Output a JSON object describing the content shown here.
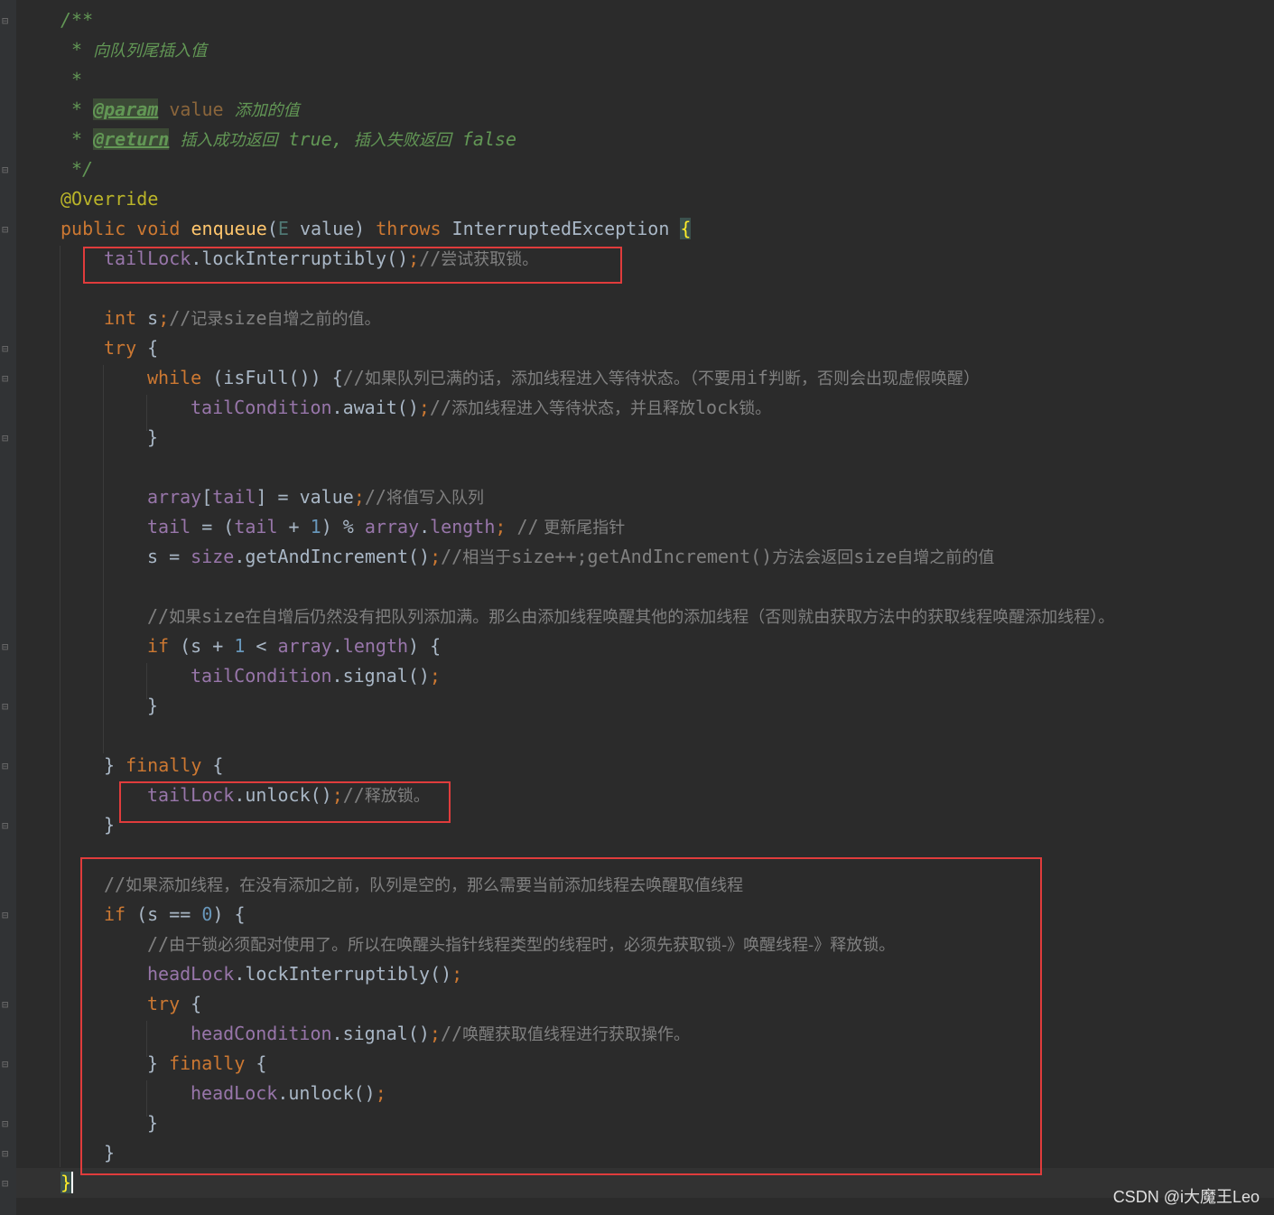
{
  "code": {
    "doc_open": "/**",
    "doc_line1_star": "*",
    "doc_line1_text": "向队列尾插入值",
    "doc_line2_star": "*",
    "doc_param_star": "*",
    "doc_param_tag": "@param",
    "doc_param_name": "value",
    "doc_param_desc": "添加的值",
    "doc_return_star": "*",
    "doc_return_tag": "@return",
    "doc_return_desc1": "插入成功返回",
    "doc_return_true": "true,",
    "doc_return_desc2": "插入失败返回",
    "doc_return_false": "false",
    "doc_close": "*/",
    "annotation": "@Override",
    "sig_public": "public",
    "sig_void": "void",
    "sig_name": "enqueue",
    "sig_paren_open": "(",
    "sig_type": "E",
    "sig_param": " value)",
    "sig_throws": "throws",
    "sig_exception": "InterruptedException",
    "sig_brace": "{",
    "l_taillock_field": "tailLock",
    "l_taillock_call": ".lockInterruptibly()",
    "l_taillock_semi": ";",
    "l_taillock_cmt_slash": "//",
    "l_taillock_cmt": "尝试获取锁。",
    "l_int_kw": "int",
    "l_int_var": " s",
    "l_int_semi": ";",
    "l_int_cmt_slash": "//",
    "l_int_cmt_a": "记录",
    "l_int_cmt_b": "size",
    "l_int_cmt_c": "自增之前的值。",
    "l_try_kw": "try",
    "l_try_brace": " {",
    "l_while_kw": "while",
    "l_while_cond": " (isFull()) {",
    "l_while_cmt_slash": "//",
    "l_while_cmt_a": "如果队列已满的话，添加线程进入等待状态。（不要用",
    "l_while_cmt_b": "if",
    "l_while_cmt_c": "判断，否则会出现虚假唤醒）",
    "l_await_field": "tailCondition",
    "l_await_call": ".await()",
    "l_await_semi": ";",
    "l_await_cmt_slash": "//",
    "l_await_cmt_a": "添加线程进入等待状态，并且释放",
    "l_await_cmt_b": "lock",
    "l_await_cmt_c": "锁。",
    "l_close1": "}",
    "l_arr_field": "array",
    "l_arr_b1": "[",
    "l_arr_tail": "tail",
    "l_arr_rest": "] = value",
    "l_arr_semi": ";",
    "l_arr_cmt_slash": "//",
    "l_arr_cmt": "将值写入队列",
    "l_tail_field": "tail",
    "l_tail_eq": " = (",
    "l_tail_field2": "tail",
    "l_tail_plus": " + ",
    "l_tail_one": "1",
    "l_tail_mod": ") % ",
    "l_tail_array": "array",
    "l_tail_dot": ".",
    "l_tail_length": "length",
    "l_tail_semi": ";",
    "l_tail_cmt_slash": " //",
    "l_tail_cmt": " 更新尾指针",
    "l_s_var": "s = ",
    "l_s_field": "size",
    "l_s_call": ".getAndIncrement()",
    "l_s_semi": ";",
    "l_s_cmt_slash": "//",
    "l_s_cmt_a": "相当于",
    "l_s_cmt_b": "size++;getAndIncrement()",
    "l_s_cmt_c": "方法会返回",
    "l_s_cmt_d": "size",
    "l_s_cmt_e": "自增之前的值",
    "l_long_cmt_slash": "//",
    "l_long_cmt_a": "如果",
    "l_long_cmt_b": "size",
    "l_long_cmt_c": "在自增后仍然没有把队列添加满。那么由添加线程唤醒其他的添加线程（否则就由获取方法中的获取线程唤醒添加线程）。",
    "l_if_kw": "if",
    "l_if_a": " (s + ",
    "l_if_one": "1",
    "l_if_lt": " < ",
    "l_if_array": "array",
    "l_if_dot": ".",
    "l_if_length": "length",
    "l_if_end": ") {",
    "l_signal_field": "tailCondition",
    "l_signal_call": ".signal()",
    "l_signal_semi": ";",
    "l_close2": "}",
    "l_finally_close": "} ",
    "l_finally_kw": "finally",
    "l_finally_brace": " {",
    "l_unlock_field": "tailLock",
    "l_unlock_call": ".unlock()",
    "l_unlock_semi": ";",
    "l_unlock_cmt_slash": "//",
    "l_unlock_cmt": "释放锁。",
    "l_close3": "}",
    "l_cmt2_slash": "//",
    "l_cmt2": "如果添加线程，在没有添加之前，队列是空的，那么需要当前添加线程去唤醒取值线程",
    "l_if2_kw": "if",
    "l_if2_a": " (s == ",
    "l_if2_zero": "0",
    "l_if2_end": ") {",
    "l_cmt3_slash": "//",
    "l_cmt3": "由于锁必须配对使用了。所以在唤醒头指针线程类型的线程时，必须先获取锁-》唤醒线程-》释放锁。",
    "l_headlock_field": "headLock",
    "l_headlock_call": ".lockInterruptibly()",
    "l_headlock_semi": ";",
    "l_try2_kw": "try",
    "l_try2_brace": " {",
    "l_hsignal_field": "headCondition",
    "l_hsignal_call": ".signal()",
    "l_hsignal_semi": ";",
    "l_hsignal_cmt_slash": "//",
    "l_hsignal_cmt": "唤醒获取值线程进行获取操作。",
    "l_finally2_close": "} ",
    "l_finally2_kw": "finally",
    "l_finally2_brace": " {",
    "l_hunlock_field": "headLock",
    "l_hunlock_call": ".unlock()",
    "l_hunlock_semi": ";",
    "l_close4": "}",
    "l_close5": "}",
    "l_final_brace": "}"
  },
  "watermark": "CSDN @i大魔王Leo",
  "colors": {
    "background": "#2b2b2b",
    "keyword": "#cc7832",
    "field": "#9876aa",
    "method": "#ffc66d",
    "comment": "#808080",
    "doc": "#629755",
    "annotation": "#bbb529",
    "number": "#6897bb",
    "highlight_box": "#e03c3c"
  }
}
